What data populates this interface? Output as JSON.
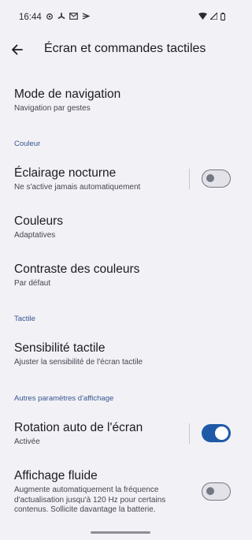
{
  "status_bar": {
    "time": "16:44",
    "left_icons": [
      "settings-gear-icon",
      "fan-icon",
      "gmail-icon",
      "pip-icon"
    ],
    "right_icons": [
      "wifi-icon",
      "signal-icon",
      "battery-icon"
    ]
  },
  "header": {
    "title": "Écran et commandes tactiles"
  },
  "items": {
    "navigation": {
      "title": "Mode de navigation",
      "subtitle": "Navigation par gestes"
    },
    "night_light": {
      "title": "Éclairage nocturne",
      "subtitle": "Ne s'active jamais automatiquement",
      "toggle": false
    },
    "colors": {
      "title": "Couleurs",
      "subtitle": "Adaptatives"
    },
    "contrast": {
      "title": "Contraste des couleurs",
      "subtitle": "Par défaut"
    },
    "touch": {
      "title": "Sensibilité tactile",
      "subtitle": "Ajuster la sensibilité de l'écran tactile"
    },
    "rotation": {
      "title": "Rotation auto de l'écran",
      "subtitle": "Activée",
      "toggle": true
    },
    "smooth": {
      "title": "Affichage fluide",
      "subtitle_lines": [
        "Augmente automatiquement la fréquence",
        "d'actualisation jusqu'à 120 Hz pour certains",
        "contenus. Sollicite davantage la batterie."
      ],
      "toggle": false
    }
  },
  "sections": {
    "color": "Couleur",
    "touch": "Tactile",
    "other": "Autres paramètres d'affichage"
  },
  "colors": {
    "background": "#f2f1f6",
    "section_header": "#36568f",
    "switch_on": "#1e5aa8",
    "switch_off_outline": "#757780"
  }
}
